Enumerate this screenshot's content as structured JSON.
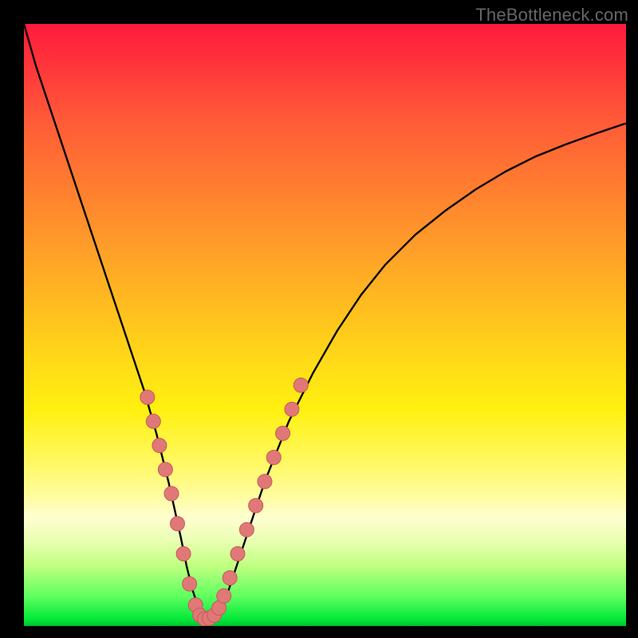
{
  "watermark": "TheBottleneck.com",
  "chart_data": {
    "type": "line",
    "title": "",
    "xlabel": "",
    "ylabel": "",
    "xlim": [
      0,
      100
    ],
    "ylim": [
      0,
      100
    ],
    "series": [
      {
        "name": "curve",
        "x": [
          0,
          2,
          4,
          6,
          8,
          10,
          12,
          14,
          16,
          18,
          20,
          22,
          24,
          26,
          27,
          28,
          29,
          30,
          31,
          32,
          33,
          34,
          36,
          38,
          40,
          44,
          48,
          52,
          56,
          60,
          65,
          70,
          75,
          80,
          85,
          90,
          95,
          100
        ],
        "y": [
          100,
          93,
          87,
          81,
          75,
          69,
          63,
          57,
          51,
          45,
          39,
          32,
          24,
          15,
          10,
          6,
          3,
          1.5,
          1.2,
          1.5,
          3,
          6,
          12,
          18,
          24,
          34,
          42,
          49,
          55,
          60,
          65,
          69,
          72.5,
          75.5,
          78,
          80,
          81.8,
          83.5
        ]
      }
    ],
    "markers": {
      "name": "dots",
      "points": [
        {
          "x": 20.5,
          "y": 38
        },
        {
          "x": 21.5,
          "y": 34
        },
        {
          "x": 22.5,
          "y": 30
        },
        {
          "x": 23.5,
          "y": 26
        },
        {
          "x": 24.5,
          "y": 22
        },
        {
          "x": 25.5,
          "y": 17
        },
        {
          "x": 26.5,
          "y": 12
        },
        {
          "x": 27.5,
          "y": 7
        },
        {
          "x": 28.5,
          "y": 3.5
        },
        {
          "x": 29.2,
          "y": 1.8
        },
        {
          "x": 30.0,
          "y": 1.2
        },
        {
          "x": 30.8,
          "y": 1.3
        },
        {
          "x": 31.6,
          "y": 1.8
        },
        {
          "x": 32.4,
          "y": 3
        },
        {
          "x": 33.2,
          "y": 5
        },
        {
          "x": 34.2,
          "y": 8
        },
        {
          "x": 35.5,
          "y": 12
        },
        {
          "x": 37.0,
          "y": 16
        },
        {
          "x": 38.5,
          "y": 20
        },
        {
          "x": 40.0,
          "y": 24
        },
        {
          "x": 41.5,
          "y": 28
        },
        {
          "x": 43.0,
          "y": 32
        },
        {
          "x": 44.5,
          "y": 36
        },
        {
          "x": 46.0,
          "y": 40
        }
      ]
    },
    "marker_color": "#e07878",
    "marker_stroke": "#c85858",
    "curve_color": "#000000"
  }
}
